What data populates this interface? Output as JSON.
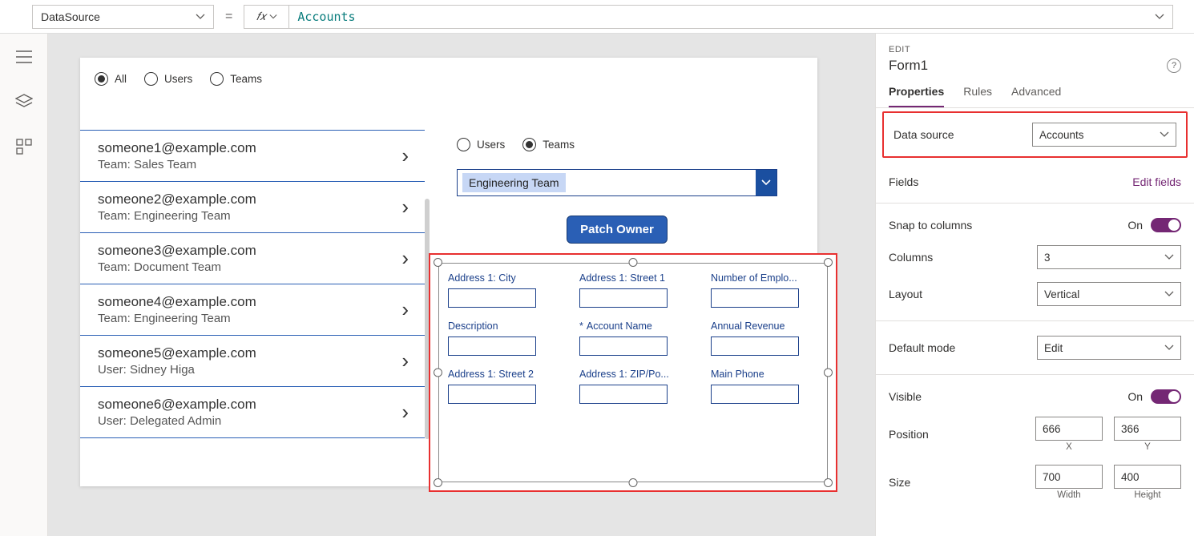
{
  "formulaBar": {
    "property": "DataSource",
    "equals": "=",
    "value": "Accounts"
  },
  "canvas": {
    "filterRadios": {
      "all": "All",
      "users": "Users",
      "teams": "Teams"
    },
    "gallery": [
      {
        "email": "someone1@example.com",
        "sub": "Team: Sales Team"
      },
      {
        "email": "someone2@example.com",
        "sub": "Team: Engineering Team"
      },
      {
        "email": "someone3@example.com",
        "sub": "Team: Document Team"
      },
      {
        "email": "someone4@example.com",
        "sub": "Team: Engineering Team"
      },
      {
        "email": "someone5@example.com",
        "sub": "User: Sidney Higa"
      },
      {
        "email": "someone6@example.com",
        "sub": "User: Delegated Admin"
      }
    ],
    "ownerRadios": {
      "users": "Users",
      "teams": "Teams"
    },
    "teamsDropdown": "Engineering Team",
    "patchButton": "Patch Owner",
    "formFields": [
      {
        "label": "Address 1: City",
        "required": false
      },
      {
        "label": "Address 1: Street 1",
        "required": false
      },
      {
        "label": "Number of Emplo...",
        "required": false
      },
      {
        "label": "Description",
        "required": false
      },
      {
        "label": "Account Name",
        "required": true
      },
      {
        "label": "Annual Revenue",
        "required": false
      },
      {
        "label": "Address 1: Street 2",
        "required": false
      },
      {
        "label": "Address 1: ZIP/Po...",
        "required": false
      },
      {
        "label": "Main Phone",
        "required": false
      }
    ]
  },
  "props": {
    "editLabel": "EDIT",
    "formName": "Form1",
    "tabs": {
      "properties": "Properties",
      "rules": "Rules",
      "advanced": "Advanced"
    },
    "dataSource": {
      "label": "Data source",
      "value": "Accounts"
    },
    "fields": {
      "label": "Fields",
      "link": "Edit fields"
    },
    "snap": {
      "label": "Snap to columns",
      "value": "On"
    },
    "columns": {
      "label": "Columns",
      "value": "3"
    },
    "layout": {
      "label": "Layout",
      "value": "Vertical"
    },
    "defaultMode": {
      "label": "Default mode",
      "value": "Edit"
    },
    "visible": {
      "label": "Visible",
      "value": "On"
    },
    "position": {
      "label": "Position",
      "x": "666",
      "y": "366",
      "xLabel": "X",
      "yLabel": "Y"
    },
    "size": {
      "label": "Size",
      "w": "700",
      "h": "400",
      "wLabel": "Width",
      "hLabel": "Height"
    }
  }
}
